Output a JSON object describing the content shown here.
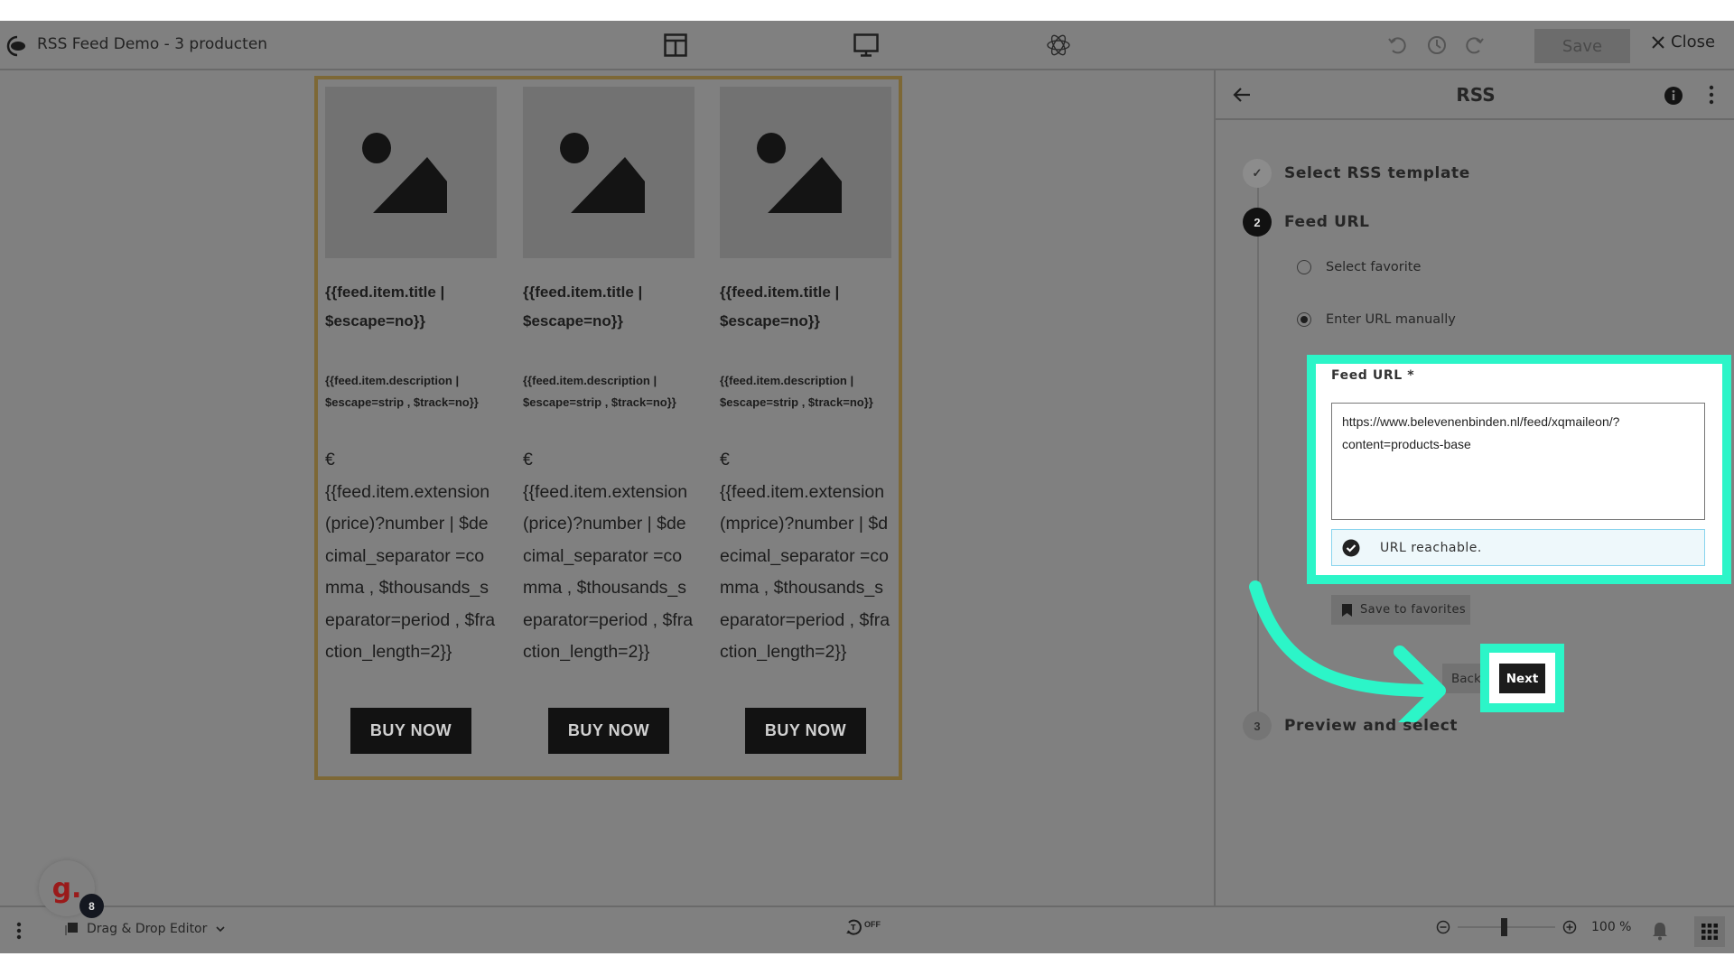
{
  "app": {
    "title": "RSS Feed Demo - 3 producten",
    "save_label": "Save",
    "close_label": "Close",
    "header_icons": [
      "layout-icon",
      "desktop-preview-icon",
      "atom-settings-icon"
    ],
    "history_icons": [
      "undo-icon",
      "history-icon",
      "redo-icon"
    ]
  },
  "template": {
    "columns": [
      {
        "title": "{{feed.item.title | $escape=no}}",
        "description": "{{feed.item.description | $escape=strip , $track=no}}",
        "currency": "€",
        "price": "{{feed.item.extension(price)?number | $decimal_separator =comma , $thousands_separator=period , $fraction_length=2}}",
        "button": "BUY NOW"
      },
      {
        "title": "{{feed.item.title | $escape=no}}",
        "description": "{{feed.item.description | $escape=strip , $track=no}}",
        "currency": "€",
        "price": "{{feed.item.extension(price)?number | $decimal_separator =comma , $thousands_separator=period , $fraction_length=2}}",
        "button": "BUY NOW"
      },
      {
        "title": "{{feed.item.title | $escape=no}}",
        "description": "{{feed.item.description | $escape=strip , $track=no}}",
        "currency": "€",
        "price": "{{feed.item.extension(mprice)?number | $decimal_separator =comma , $thousands_separator=period , $fraction_length=2}}",
        "button": "BUY NOW"
      }
    ]
  },
  "panel": {
    "title": "RSS",
    "steps": [
      {
        "number": "✓",
        "label": "Select RSS template",
        "state": "done"
      },
      {
        "number": "2",
        "label": "Feed URL",
        "state": "active"
      },
      {
        "number": "3",
        "label": "Preview and select",
        "state": "pending"
      }
    ],
    "options": [
      {
        "label": "Select favorite",
        "selected": false
      },
      {
        "label": "Enter URL manually",
        "selected": true
      }
    ],
    "feed_url_label": "Feed URL *",
    "feed_url_value": "https://www.belevenenbinden.nl/feed/xqmaileon/?content=products-base",
    "status_text": "URL reachable.",
    "save_favorites_label": "Save to favorites",
    "back_label": "Back",
    "next_label": "Next"
  },
  "footer": {
    "editor_label": "Drag & Drop Editor",
    "autosave_label": "OFF",
    "zoom_value": "100 %",
    "zoom_percent": 100,
    "avatar_letter": "g.",
    "notification_count": "8"
  },
  "colors": {
    "highlight": "#2cf5c8",
    "template_border": "#7d6836",
    "overlay": "#808080",
    "avatar_letter": "#9a1a1a"
  }
}
